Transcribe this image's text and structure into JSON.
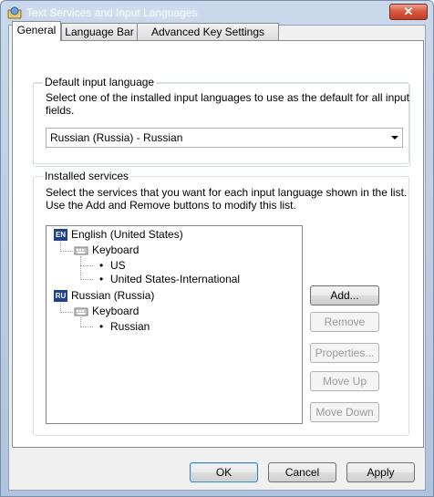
{
  "window": {
    "title": "Text Services and Input Languages",
    "close_glyph": "✕"
  },
  "tabs": [
    {
      "label": "General",
      "active": true
    },
    {
      "label": "Language Bar",
      "active": false
    },
    {
      "label": "Advanced Key Settings",
      "active": false
    }
  ],
  "default_language": {
    "group_label": "Default input language",
    "description": "Select one of the installed input languages to use as the default for all input fields.",
    "selected_value": "Russian (Russia) - Russian"
  },
  "installed_services": {
    "group_label": "Installed services",
    "description": "Select the services that you want for each input language shown in the list. Use the Add and Remove buttons to modify this list.",
    "tree": [
      {
        "badge": "EN",
        "badge_color": "#1f3f8f",
        "language": "English (United States)",
        "category": "Keyboard",
        "items": [
          "US",
          "United States-International"
        ]
      },
      {
        "badge": "RU",
        "badge_color": "#1f3f8f",
        "language": "Russian (Russia)",
        "category": "Keyboard",
        "items": [
          "Russian"
        ]
      }
    ],
    "buttons": {
      "add": "Add...",
      "remove": "Remove",
      "properties": "Properties...",
      "move_up": "Move Up",
      "move_down": "Move Down"
    }
  },
  "footer": {
    "ok": "OK",
    "cancel": "Cancel",
    "apply": "Apply"
  },
  "colors": {
    "accent": "#3c7fb1",
    "close_button": "#d8553e"
  }
}
